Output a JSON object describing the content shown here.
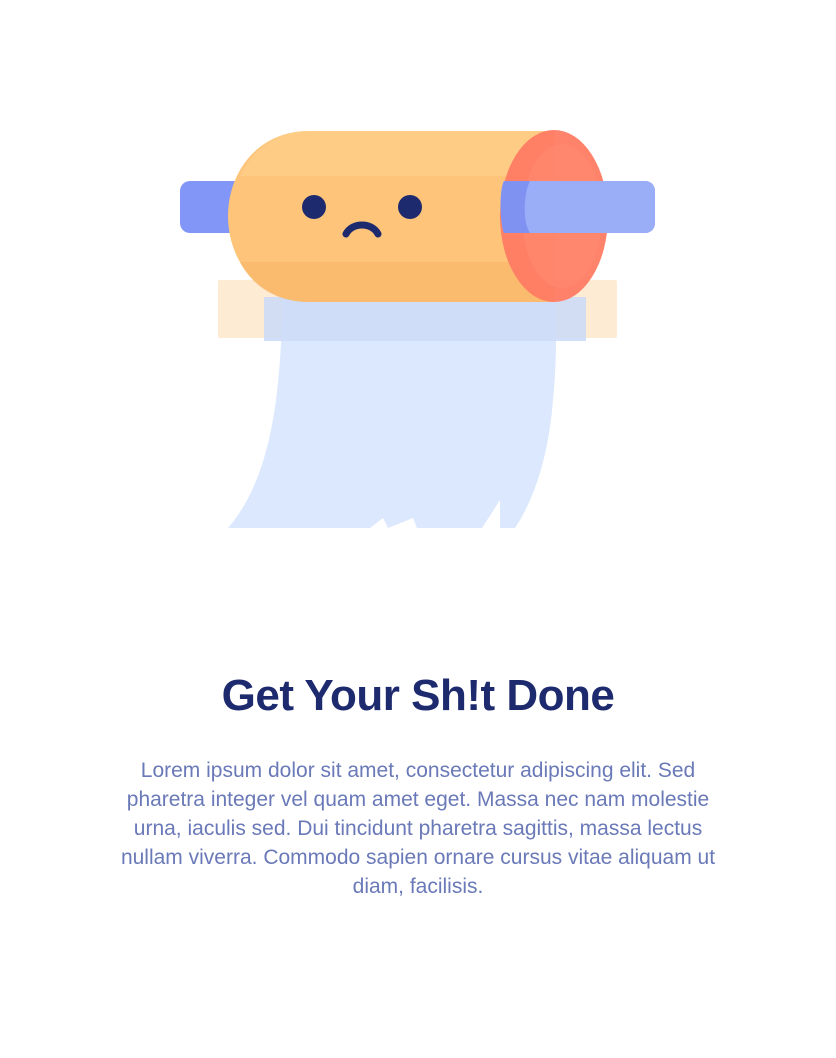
{
  "illustration": {
    "label": "toilet-paper-roll-illustration",
    "colors": {
      "roll": "#fdc47a",
      "roll_end": "#ff7b63",
      "holder_bar": "#8196f6",
      "paper": "#dce8fd",
      "face": "#1d2a6e",
      "shadow": "#fdebd4"
    }
  },
  "heading": {
    "title": "Get Your Sh!t Done"
  },
  "content": {
    "description": "Lorem ipsum dolor sit amet, consectetur adipiscing elit. Sed pharetra integer vel quam amet eget. Massa nec nam molestie urna, iaculis sed. Dui tincidunt pharetra sagittis, massa lectus nullam viverra. Commodo sapien ornare cursus vitae aliquam ut diam, facilisis."
  },
  "theme": {
    "title_color": "#1d2a6e",
    "text_color": "#6a79b8",
    "background": "#ffffff"
  }
}
